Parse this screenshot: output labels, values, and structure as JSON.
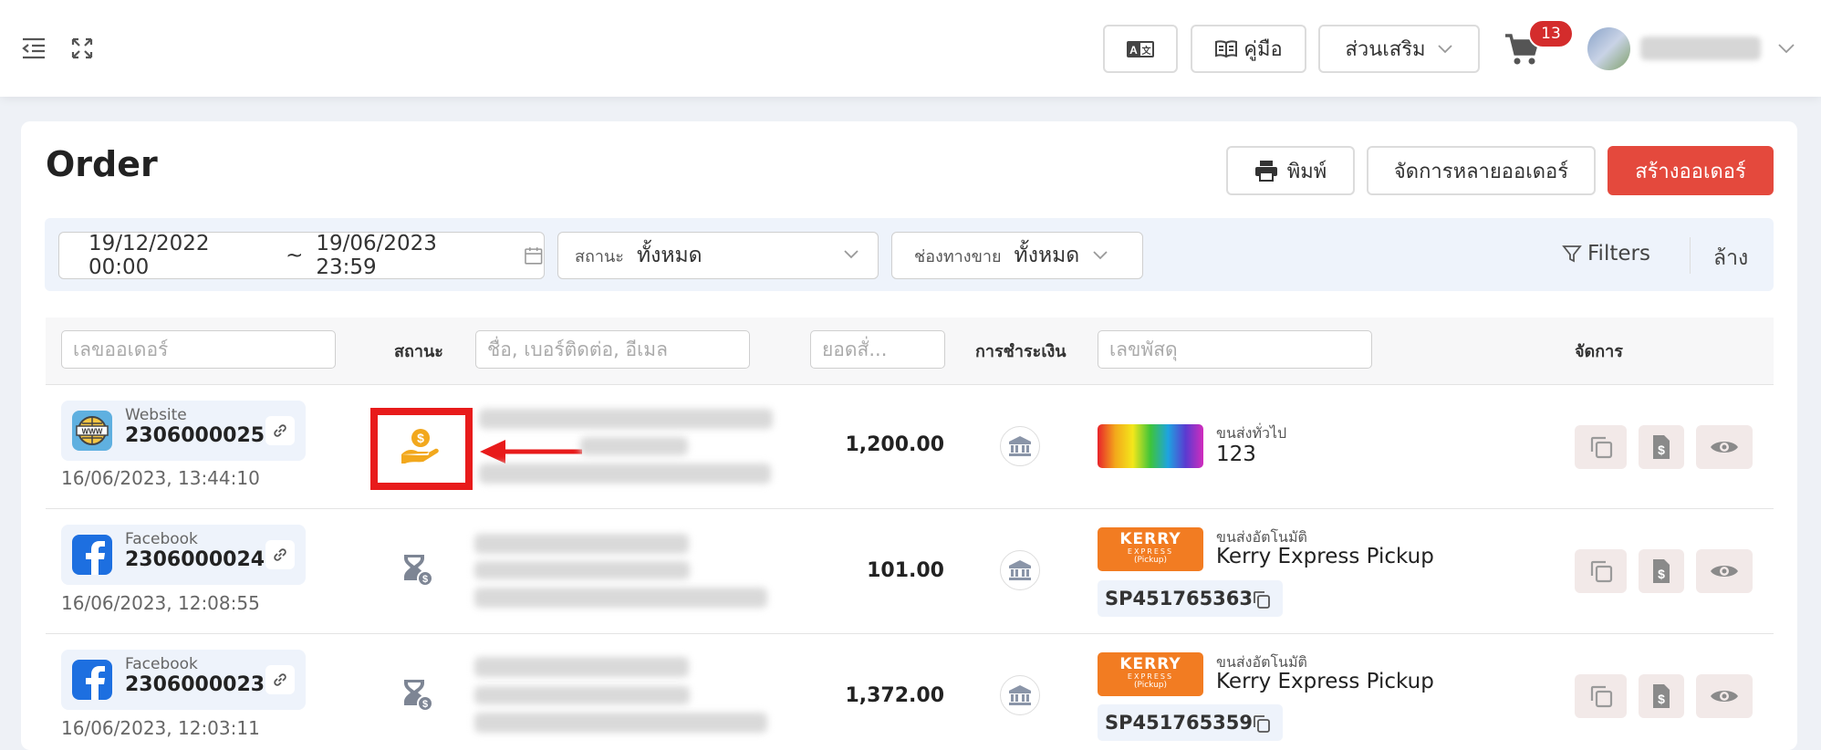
{
  "topbar": {
    "manual_label": "คู่มือ",
    "addons_label": "ส่วนเสริม",
    "cart_count": "13"
  },
  "page": {
    "title": "Order",
    "print_label": "พิมพ์",
    "bulk_label": "จัดการหลายออเดอร์",
    "create_label": "สร้างออเดอร์"
  },
  "filters": {
    "date_start": "19/12/2022 00:00",
    "date_sep": "~",
    "date_end": "19/06/2023 23:59",
    "status_label": "สถานะ",
    "status_value": "ทั้งหมด",
    "channel_label": "ช่องทางขาย",
    "channel_value": "ทั้งหมด",
    "filters_label": "Filters",
    "clear_label": "ล้าง"
  },
  "table": {
    "order_placeholder": "เลขออเดอร์",
    "status_header": "สถานะ",
    "customer_placeholder": "ชื่อ, เบอร์ติดต่อ, อีเมล",
    "total_placeholder": "ยอดสั่...",
    "payment_header": "การชำระเงิน",
    "tracking_placeholder": "เลขพัสดุ",
    "actions_header": "จัดการ",
    "rows": [
      {
        "source": "Website",
        "order_no": "2306000025",
        "datetime": "16/06/2023, 13:44:10",
        "amount": "1,200.00",
        "ship_type": "ขนส่งทั่วไป",
        "ship_name": "123",
        "tracking": ""
      },
      {
        "source": "Facebook",
        "order_no": "2306000024",
        "datetime": "16/06/2023, 12:08:55",
        "amount": "101.00",
        "ship_type": "ขนส่งอัตโนมัติ",
        "ship_name": "Kerry Express Pickup",
        "tracking": "SP451765363"
      },
      {
        "source": "Facebook",
        "order_no": "2306000023",
        "datetime": "16/06/2023, 12:03:11",
        "amount": "1,372.00",
        "ship_type": "ขนส่งอัตโนมัติ",
        "ship_name": "Kerry Express Pickup",
        "tracking": "SP451765359"
      }
    ]
  },
  "carrier_logo": {
    "brand": "KERRY",
    "sub": "EXPRESS",
    "tag": "(Pickup)"
  },
  "colors": {
    "accent": "#e4493d",
    "highlight_box": "#e81b1b",
    "kerry": "#f27c22",
    "coin": "#f2a81d",
    "filterbar": "#eef3fb"
  }
}
